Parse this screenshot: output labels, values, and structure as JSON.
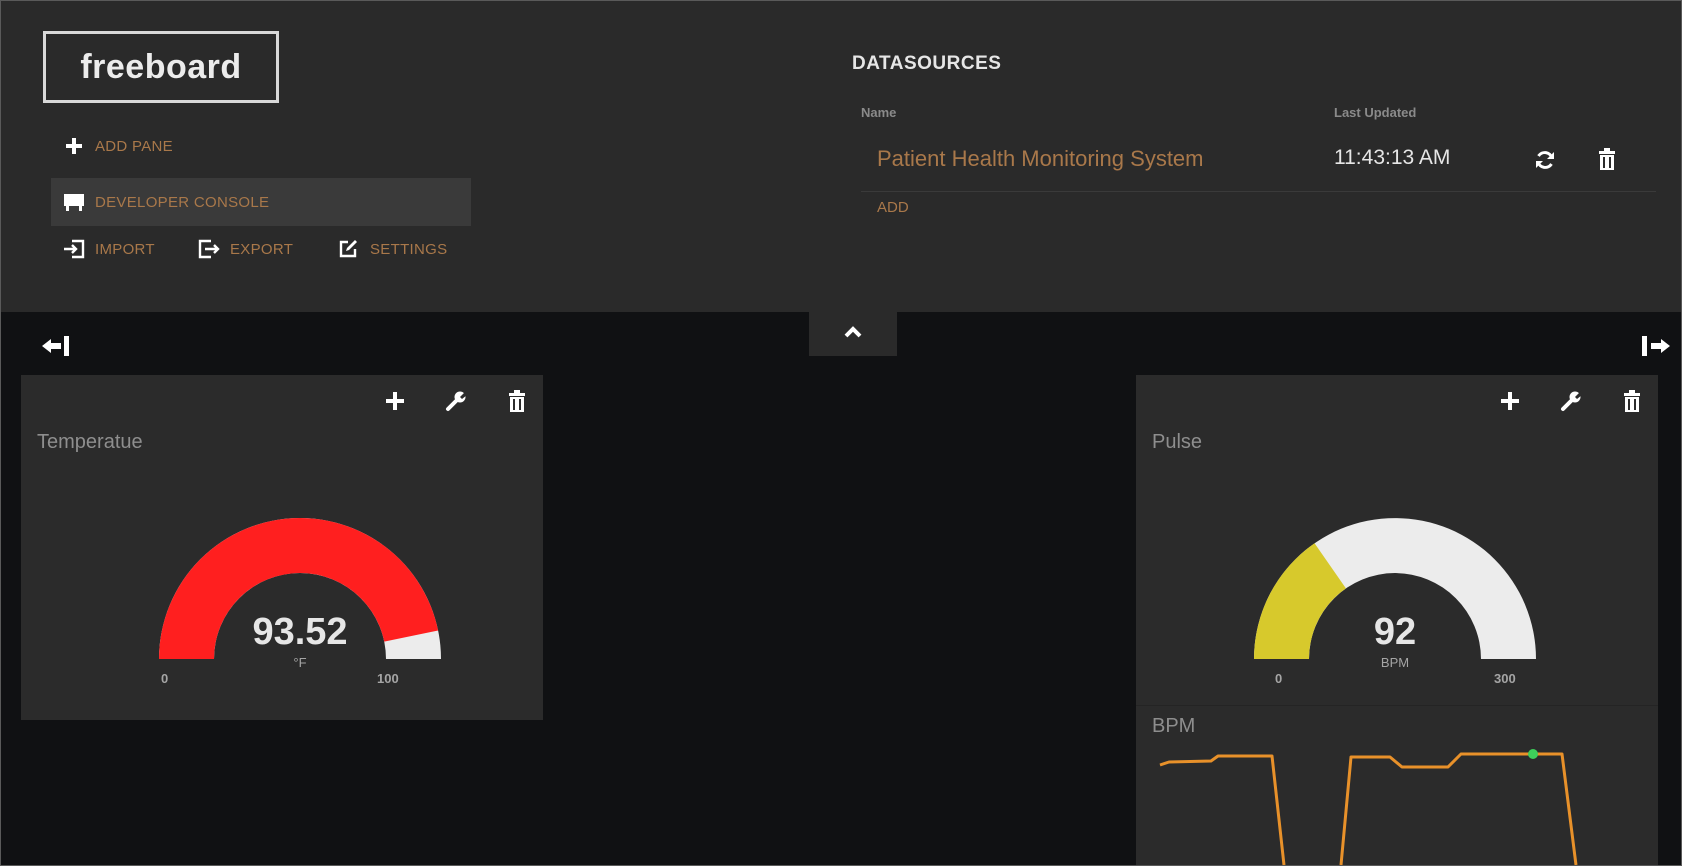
{
  "app": {
    "logo": "freeboard"
  },
  "menu": {
    "add_pane": "ADD PANE",
    "developer_console": "DEVELOPER CONSOLE",
    "import": "IMPORT",
    "export": "EXPORT",
    "settings": "SETTINGS"
  },
  "datasources": {
    "title": "DATASOURCES",
    "columns": {
      "name": "Name",
      "last_updated": "Last Updated"
    },
    "rows": [
      {
        "name": "Patient Health Monitoring System",
        "last_updated": "11:43:13 AM"
      }
    ],
    "add_label": "ADD"
  },
  "panes": {
    "temperature": {
      "title": "Temperatue",
      "gauge": {
        "value": "93.52",
        "unit": "°F",
        "min": "0",
        "max": "100",
        "fraction": 0.9352,
        "fill_color": "#ff1f1f",
        "track_color": "#ececec"
      }
    },
    "pulse": {
      "title": "Pulse",
      "gauge": {
        "value": "92",
        "unit": "BPM",
        "min": "0",
        "max": "300",
        "fraction": 0.3067,
        "fill_color": "#d7c92c",
        "track_color": "#ececec"
      },
      "sparkline": {
        "title": "BPM",
        "line_color": "#e8912a",
        "marker_color": "#3ecf5a"
      }
    }
  },
  "colors": {
    "accent": "#a9784a",
    "header_bg": "#2a2a2a",
    "board_bg": "#101113",
    "pane_bg": "#2b2b2b"
  },
  "icons": [
    "plus-icon",
    "console-icon",
    "import-icon",
    "export-icon",
    "settings-icon",
    "refresh-icon",
    "trash-icon",
    "chevron-up-icon",
    "wrench-icon",
    "collapse-left-icon",
    "expand-right-icon"
  ]
}
